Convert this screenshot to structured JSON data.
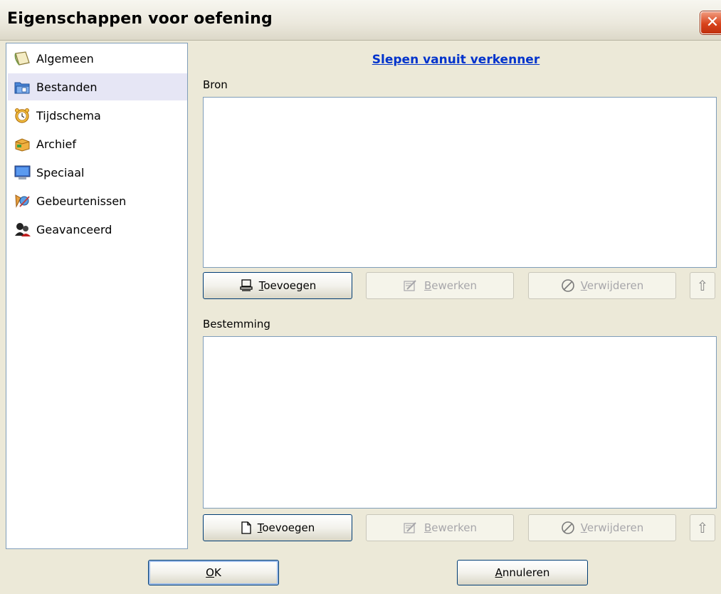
{
  "window": {
    "title": "Eigenschappen voor oefening",
    "close_glyph": "✕"
  },
  "nav": {
    "items": [
      {
        "label": "Algemeen",
        "icon": "notepad-icon",
        "selected": false
      },
      {
        "label": "Bestanden",
        "icon": "folder-icon",
        "selected": true
      },
      {
        "label": "Tijdschema",
        "icon": "alarm-clock-icon",
        "selected": false
      },
      {
        "label": "Archief",
        "icon": "archive-box-icon",
        "selected": false
      },
      {
        "label": "Speciaal",
        "icon": "monitor-icon",
        "selected": false
      },
      {
        "label": "Gebeurtenissen",
        "icon": "events-icon",
        "selected": false
      },
      {
        "label": "Geavanceerd",
        "icon": "advanced-users-icon",
        "selected": false
      }
    ]
  },
  "panel": {
    "drag_link": "Slepen vanuit verkenner",
    "source": {
      "label": "Bron",
      "add": {
        "mnemonic": "T",
        "rest": "oevoegen",
        "icon": "computer-icon"
      },
      "edit": {
        "mnemonic": "B",
        "rest": "ewerken",
        "icon": "edit-icon"
      },
      "remove": {
        "mnemonic": "V",
        "rest": "erwijderen",
        "icon": "no-entry-icon"
      },
      "up_glyph": "⇧"
    },
    "destination": {
      "label": "Bestemming",
      "add": {
        "mnemonic": "T",
        "rest": "oevoegen",
        "icon": "new-document-icon"
      },
      "edit": {
        "mnemonic": "B",
        "rest": "ewerken",
        "icon": "edit-icon"
      },
      "remove": {
        "mnemonic": "V",
        "rest": "erwijderen",
        "icon": "no-entry-icon"
      },
      "up_glyph": "⇧"
    }
  },
  "footer": {
    "ok": {
      "mnemonic": "O",
      "rest": "K"
    },
    "cancel": {
      "mnemonic": "A",
      "rest": "nnuleren"
    }
  },
  "colors": {
    "link": "#0033cc",
    "selected_bg": "#e6e6f5",
    "close_red": "#d8431c"
  }
}
